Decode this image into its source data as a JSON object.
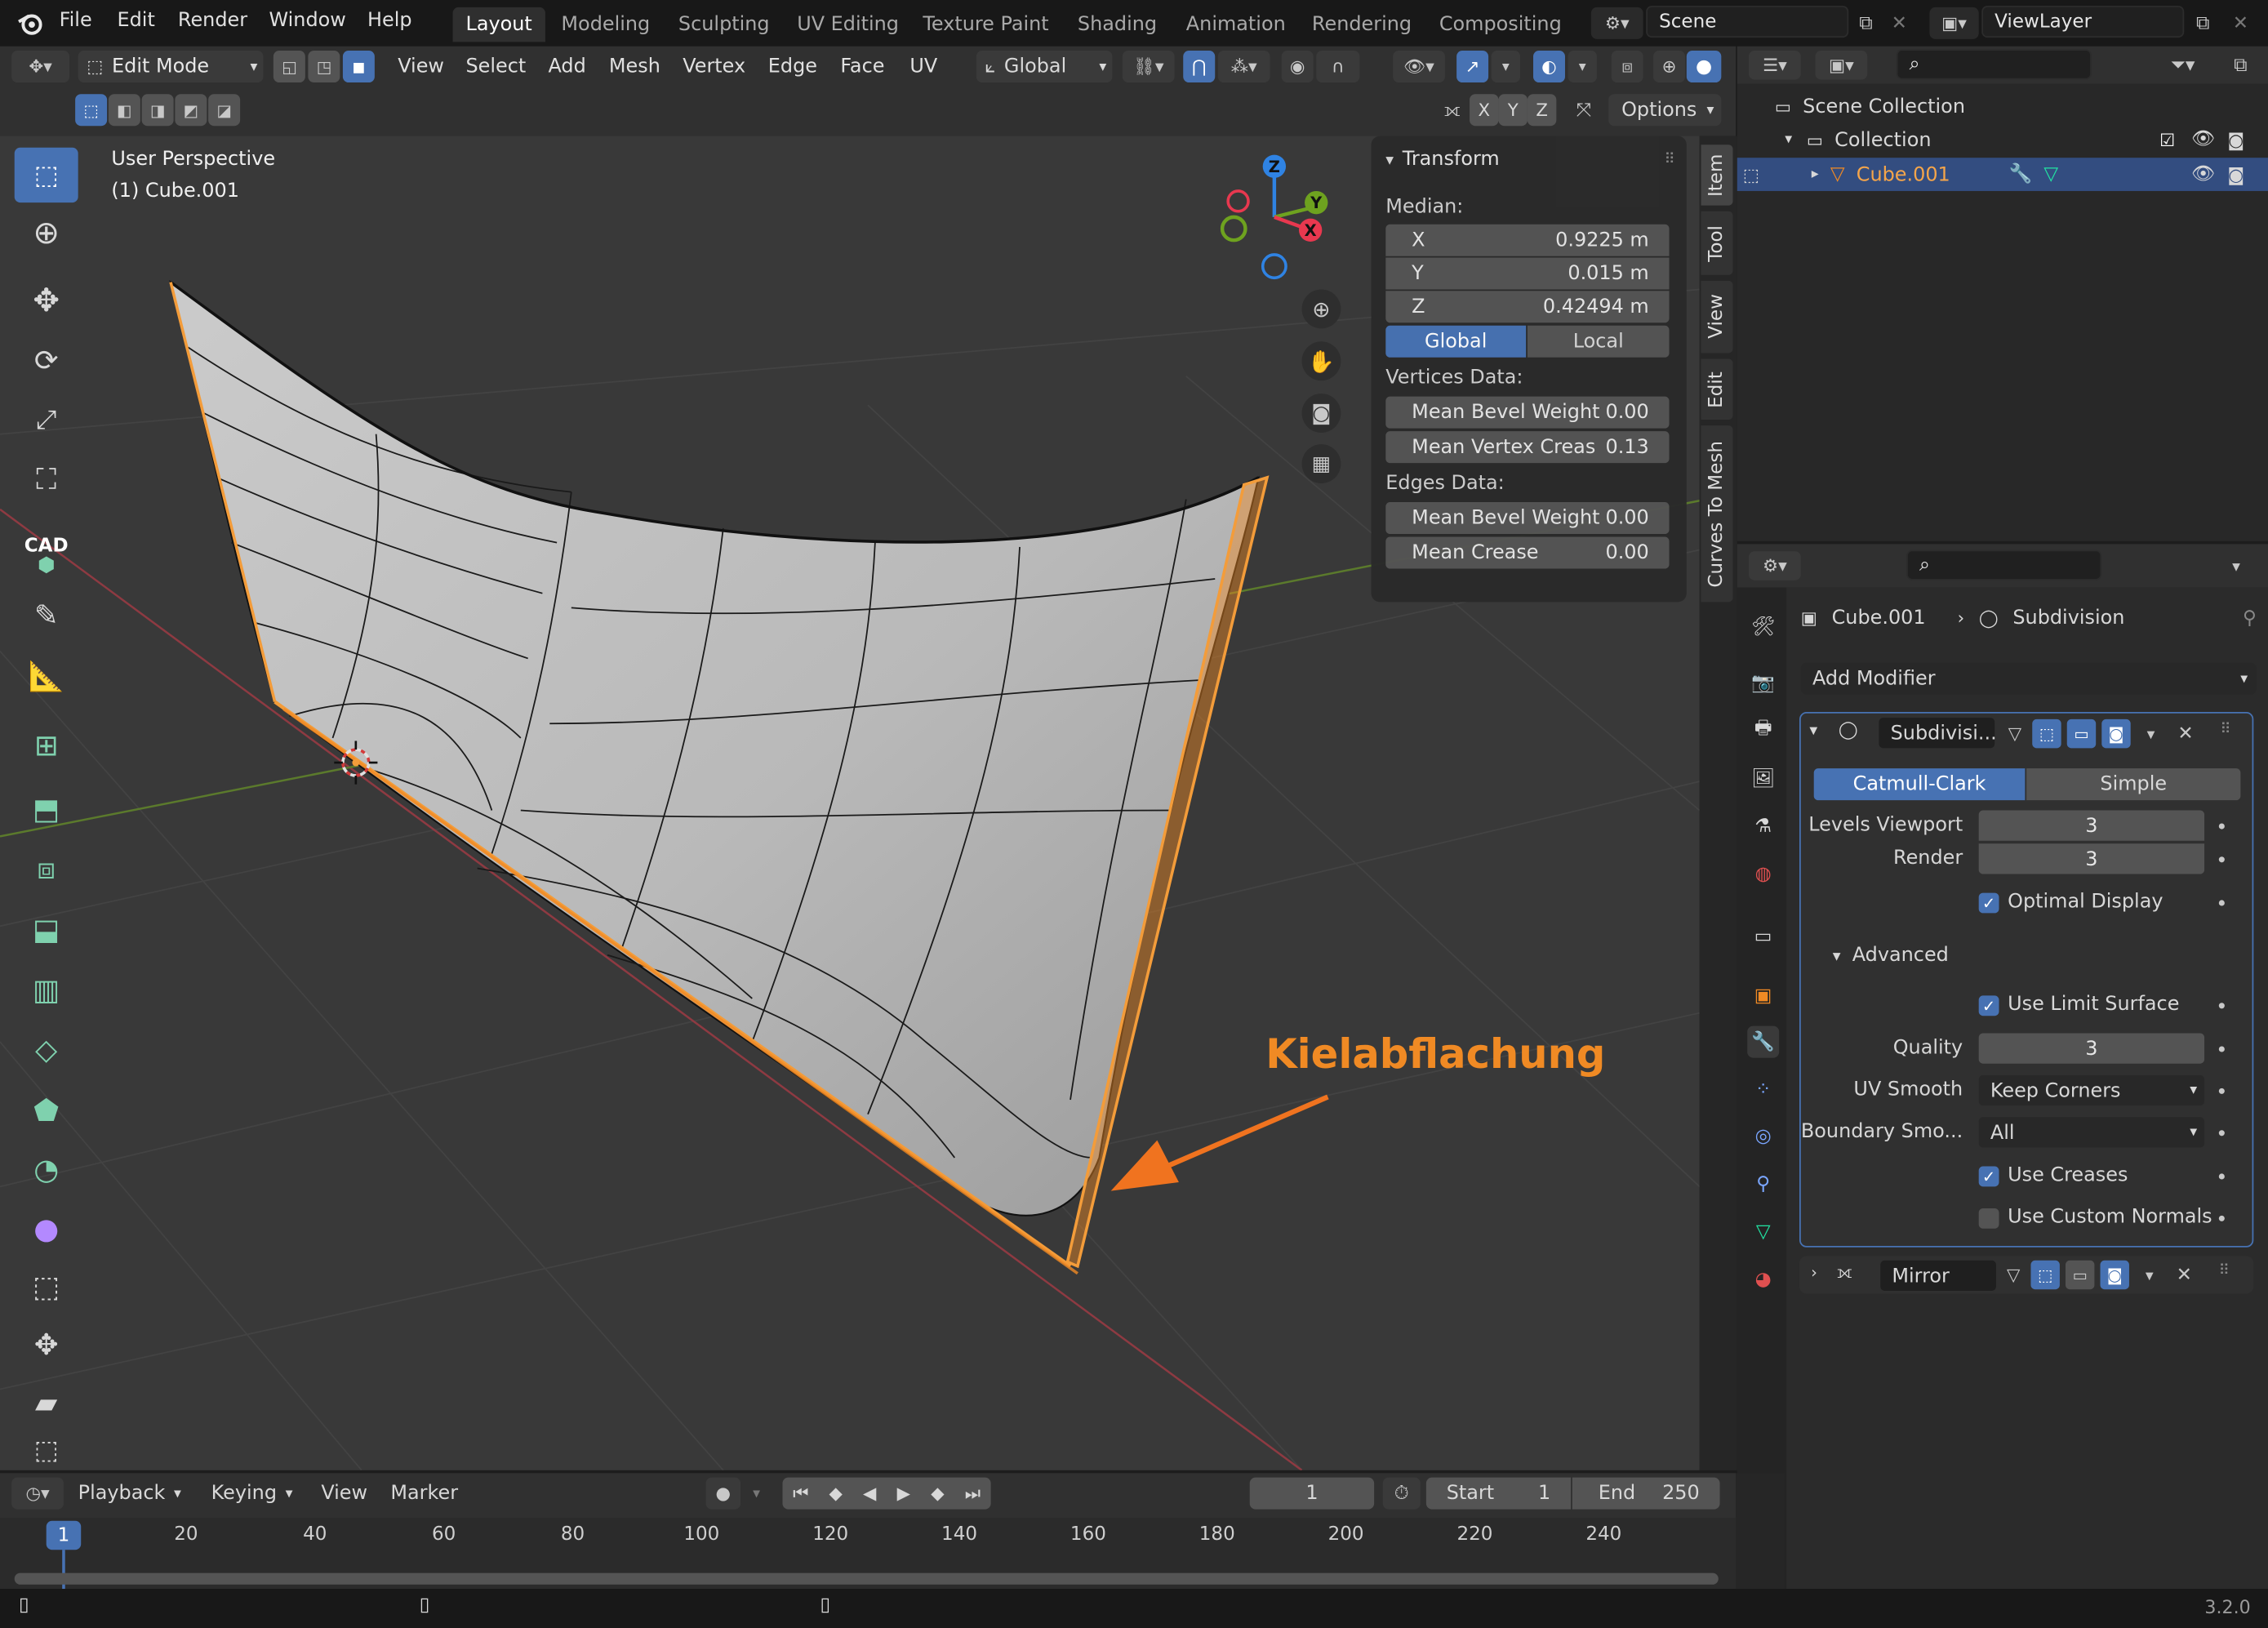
{
  "topbar": {
    "menus": [
      "File",
      "Edit",
      "Render",
      "Window",
      "Help"
    ],
    "workspaces": [
      "Layout",
      "Modeling",
      "Sculpting",
      "UV Editing",
      "Texture Paint",
      "Shading",
      "Animation",
      "Rendering",
      "Compositing"
    ],
    "active_workspace": "Layout",
    "scene": "Scene",
    "view_layer": "ViewLayer"
  },
  "viewport_header": {
    "mode": "Edit Mode",
    "menus": [
      "View",
      "Select",
      "Add",
      "Mesh",
      "Vertex",
      "Edge",
      "Face",
      "UV"
    ],
    "orientation": "Global",
    "axes": [
      "X",
      "Y",
      "Z"
    ],
    "options": "Options"
  },
  "viewport": {
    "view_name": "User Perspective",
    "object_name": "(1) Cube.001",
    "annotation": "Kielabflachung",
    "annotation_color": "#f08a24",
    "gizmo_labels": {
      "z": "Z",
      "y": "Y",
      "x": "X"
    },
    "axis_colors": {
      "x": "#e8384f",
      "y": "#6ea21f",
      "z": "#2f83e3"
    }
  },
  "tool_icons": [
    "select-box-icon",
    "cursor-icon",
    "move-icon",
    "rotate-icon",
    "scale-icon",
    "transform-icon",
    "cad-icon",
    "annotate-icon",
    "measure-icon",
    "add-cube-icon",
    "extrude-icon",
    "inset-icon",
    "bevel-icon",
    "loop-cut-icon",
    "knife-icon",
    "poly-build-icon",
    "spin-icon",
    "smooth-icon",
    "edge-slide-icon",
    "shrink-fatten-icon",
    "shear-icon",
    "rip-icon"
  ],
  "cad_label": "CAD",
  "npanel": {
    "title": "Transform",
    "median_label": "Median:",
    "x": {
      "label": "X",
      "value": "0.9225 m"
    },
    "y": {
      "label": "Y",
      "value": "0.015 m"
    },
    "z": {
      "label": "Z",
      "value": "0.42494 m"
    },
    "global": "Global",
    "local": "Local",
    "vertices_label": "Vertices Data:",
    "mean_bevel_weight_v": {
      "label": "Mean Bevel Weight",
      "value": "0.00"
    },
    "mean_vertex_crease": {
      "label": "Mean Vertex Creas",
      "value": "0.13"
    },
    "edges_label": "Edges Data:",
    "mean_bevel_weight_e": {
      "label": "Mean Bevel Weight",
      "value": "0.00"
    },
    "mean_crease": {
      "label": "Mean Crease",
      "value": "0.00"
    },
    "tabs": [
      "Item",
      "Tool",
      "View",
      "Edit",
      "Curves To Mesh"
    ]
  },
  "outliner": {
    "scene_collection": "Scene Collection",
    "collection": "Collection",
    "object": "Cube.001"
  },
  "properties": {
    "breadcrumb_object": "Cube.001",
    "breadcrumb_modifier": "Subdivision",
    "add_modifier": "Add Modifier",
    "subdiv_name": "Subdivisi...",
    "catmull": "Catmull-Clark",
    "simple": "Simple",
    "levels_viewport": {
      "label": "Levels Viewport",
      "value": "3"
    },
    "render": {
      "label": "Render",
      "value": "3"
    },
    "optimal_display": "Optimal Display",
    "advanced": "Advanced",
    "use_limit_surface": "Use Limit Surface",
    "quality": {
      "label": "Quality",
      "value": "3"
    },
    "uv_smooth": {
      "label": "UV Smooth",
      "value": "Keep Corners"
    },
    "boundary_smooth": {
      "label": "Boundary Smo...",
      "value": "All"
    },
    "use_creases": "Use Creases",
    "use_custom_normals": "Use Custom Normals",
    "mirror_name": "Mirror"
  },
  "timeline": {
    "menus": [
      "Playback",
      "Keying",
      "View",
      "Marker"
    ],
    "current_frame": "1",
    "start_label": "Start",
    "start": "1",
    "end_label": "End",
    "end": "250",
    "ruler": [
      "20",
      "40",
      "60",
      "80",
      "100",
      "120",
      "140",
      "160",
      "180",
      "200",
      "220",
      "240"
    ],
    "playhead": "1"
  },
  "statusbar": {
    "version": "3.2.0"
  }
}
